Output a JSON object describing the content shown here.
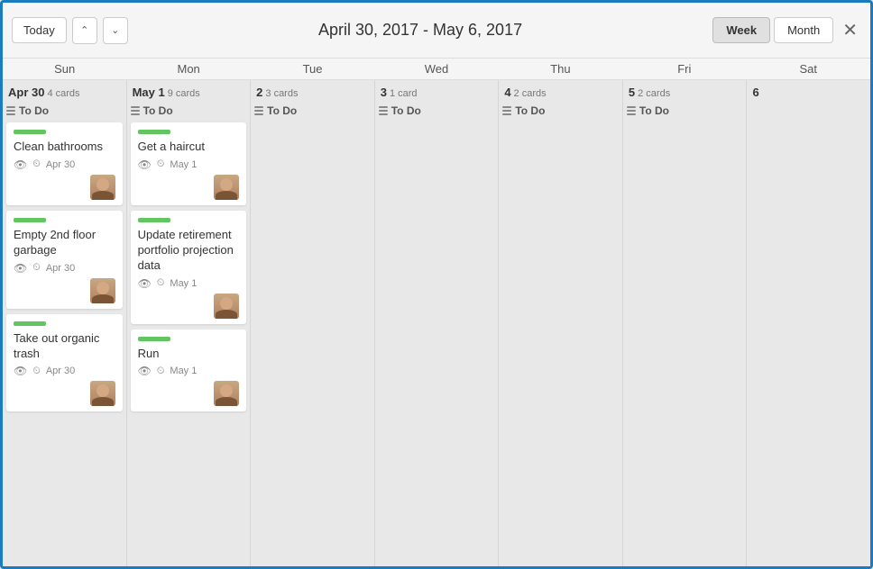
{
  "header": {
    "today_label": "Today",
    "title": "April 30, 2017 - May 6, 2017",
    "week_label": "Week",
    "month_label": "Month"
  },
  "day_headers": [
    {
      "short": "Sun"
    },
    {
      "short": "Mon"
    },
    {
      "short": "Tue"
    },
    {
      "short": "Wed"
    },
    {
      "short": "Thu"
    },
    {
      "short": "Fri"
    },
    {
      "short": "Sat"
    }
  ],
  "days": [
    {
      "num": "Apr 30",
      "card_count": "4 cards",
      "list_label": "To Do",
      "cards": [
        {
          "label_color": "#61c660",
          "title": "Clean bathrooms",
          "date": "Apr 30",
          "has_eye": true,
          "has_clock": true,
          "has_avatar": true
        },
        {
          "label_color": "#61c660",
          "title": "Empty 2nd floor garbage",
          "date": "Apr 30",
          "has_eye": true,
          "has_clock": true,
          "has_avatar": true
        },
        {
          "label_color": "#61c660",
          "title": "Take out organic trash",
          "date": "Apr 30",
          "has_eye": true,
          "has_clock": true,
          "has_avatar": true
        }
      ]
    },
    {
      "num": "May 1",
      "card_count": "9 cards",
      "list_label": "To Do",
      "cards": [
        {
          "label_color": "#61c660",
          "title": "Get a haircut",
          "date": "May 1",
          "has_eye": true,
          "has_clock": true,
          "has_avatar": true
        },
        {
          "label_color": "#61c660",
          "title": "Update retirement portfolio projection data",
          "date": "May 1",
          "has_eye": true,
          "has_clock": true,
          "has_avatar": true
        },
        {
          "label_color": "#61c660",
          "title": "Run",
          "date": "May 1",
          "has_eye": true,
          "has_clock": true,
          "has_avatar": true
        }
      ]
    },
    {
      "num": "2",
      "card_count": "3 cards",
      "list_label": "To Do",
      "cards": []
    },
    {
      "num": "3",
      "card_count": "1 card",
      "list_label": "To Do",
      "cards": []
    },
    {
      "num": "4",
      "card_count": "2 cards",
      "list_label": "To Do",
      "cards": []
    },
    {
      "num": "5",
      "card_count": "2 cards",
      "list_label": "To Do",
      "cards": []
    },
    {
      "num": "6",
      "card_count": "",
      "list_label": "",
      "cards": []
    }
  ]
}
